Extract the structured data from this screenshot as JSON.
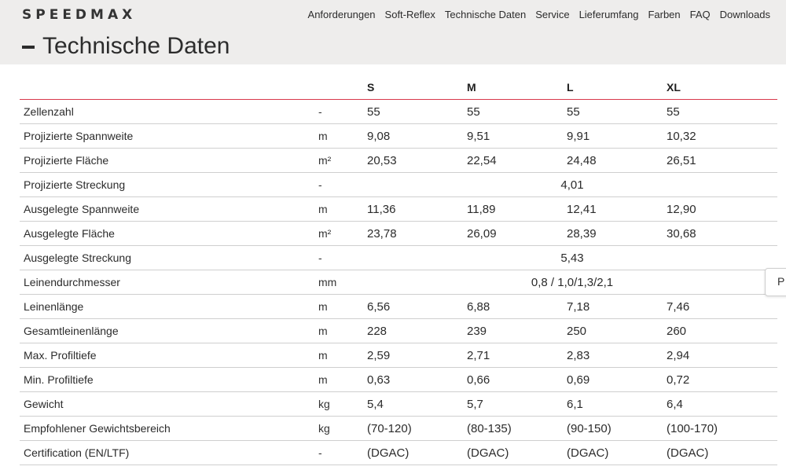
{
  "header": {
    "logo": "SPEEDMAX",
    "nav": [
      "Anforderungen",
      "Soft-Reflex",
      "Technische Daten",
      "Service",
      "Lieferumfang",
      "Farben",
      "FAQ",
      "Downloads"
    ]
  },
  "page_title": "Technische Daten",
  "table": {
    "sizes": [
      "S",
      "M",
      "L",
      "XL"
    ],
    "rows": [
      {
        "label": "Zellenzahl",
        "unit": "-",
        "values": [
          "55",
          "55",
          "55",
          "55"
        ]
      },
      {
        "label": "Projizierte Spannweite",
        "unit": "m",
        "values": [
          "9,08",
          "9,51",
          "9,91",
          "10,32"
        ]
      },
      {
        "label": "Projizierte Fläche",
        "unit": "m²",
        "values": [
          "20,53",
          "22,54",
          "24,48",
          "26,51"
        ]
      },
      {
        "label": "Projizierte Streckung",
        "unit": "-",
        "merged": "4,01"
      },
      {
        "label": "Ausgelegte Spannweite",
        "unit": "m",
        "values": [
          "11,36",
          "11,89",
          "12,41",
          "12,90"
        ]
      },
      {
        "label": "Ausgelegte Fläche",
        "unit": "m²",
        "values": [
          "23,78",
          "26,09",
          "28,39",
          "30,68"
        ]
      },
      {
        "label": "Ausgelegte Streckung",
        "unit": "-",
        "merged": "5,43"
      },
      {
        "label": "Leinendurchmesser",
        "unit": "mm",
        "merged": "0,8 / 1,0/1,3/2,1"
      },
      {
        "label": "Leinenlänge",
        "unit": "m",
        "values": [
          "6,56",
          "6,88",
          "7,18",
          "7,46"
        ]
      },
      {
        "label": "Gesamtleinenlänge",
        "unit": "m",
        "values": [
          "228",
          "239",
          "250",
          "260"
        ]
      },
      {
        "label": "Max. Profiltiefe",
        "unit": "m",
        "values": [
          "2,59",
          "2,71",
          "2,83",
          "2,94"
        ]
      },
      {
        "label": "Min. Profiltiefe",
        "unit": "m",
        "values": [
          "0,63",
          "0,66",
          "0,69",
          "0,72"
        ]
      },
      {
        "label": "Gewicht",
        "unit": "kg",
        "values": [
          "5,4",
          "5,7",
          "6,1",
          "6,4"
        ]
      },
      {
        "label": "Empfohlener Gewichtsbereich",
        "unit": "kg",
        "values": [
          "(70-120)",
          "(80-135)",
          "(90-150)",
          "(100-170)"
        ]
      },
      {
        "label": "Certification (EN/LTF)",
        "unit": "-",
        "values": [
          "(DGAC)",
          "(DGAC)",
          "(DGAC)",
          "(DGAC)"
        ]
      }
    ]
  },
  "side_tab": {
    "label": "P"
  },
  "colors": {
    "accent": "#d8394c",
    "header_bg": "#eeedec",
    "divider": "#cfcfcf"
  }
}
